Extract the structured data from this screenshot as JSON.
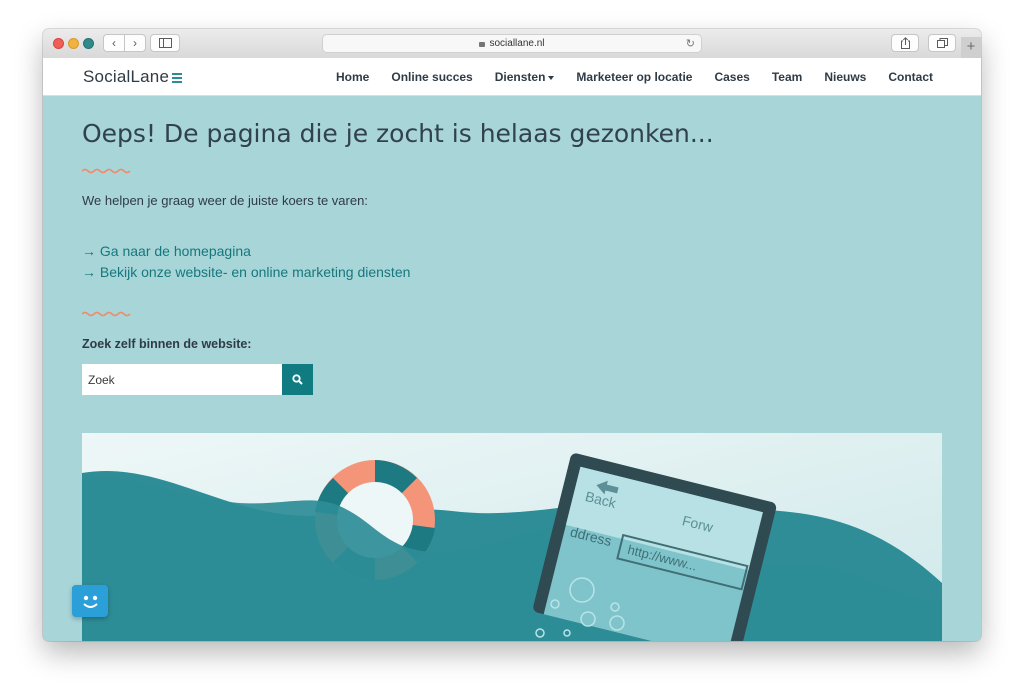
{
  "browser": {
    "url": "sociallane.nl",
    "nav_back": "‹",
    "nav_forward": "›",
    "reload": "↻",
    "new_tab": "+"
  },
  "site": {
    "logo": "SocialLane",
    "menu": [
      {
        "label": "Home"
      },
      {
        "label": "Online succes"
      },
      {
        "label": "Diensten",
        "dropdown": true
      },
      {
        "label": "Marketeer op locatie"
      },
      {
        "label": "Cases"
      },
      {
        "label": "Team"
      },
      {
        "label": "Nieuws"
      },
      {
        "label": "Contact"
      }
    ]
  },
  "page": {
    "title": "Oeps! De pagina die je zocht is helaas gezonken...",
    "intro": "We helpen je graag weer de juiste koers te varen:",
    "links": [
      "→ Ga naar de homepagina",
      "→ Bekijk onze website- en online marketing diensten"
    ],
    "search_label": "Zoek zelf binnen de website:",
    "search_placeholder": "Zoek"
  },
  "illustration": {
    "laptop_text_back": "Back",
    "laptop_text_forward": "Forw",
    "laptop_text_address": "ddress",
    "laptop_text_url": "http://www..."
  },
  "colors": {
    "page_background": "#a8d5d8",
    "accent": "#107c82",
    "link": "#16787d",
    "wave_accent": "#f08a6a",
    "life_ring_orange": "#f4957a",
    "sea": "#2e8d97"
  },
  "icons": [
    "search-icon",
    "chat-bot-icon",
    "lock-icon",
    "share-icon",
    "tabs-icon",
    "sidebar-icon"
  ]
}
